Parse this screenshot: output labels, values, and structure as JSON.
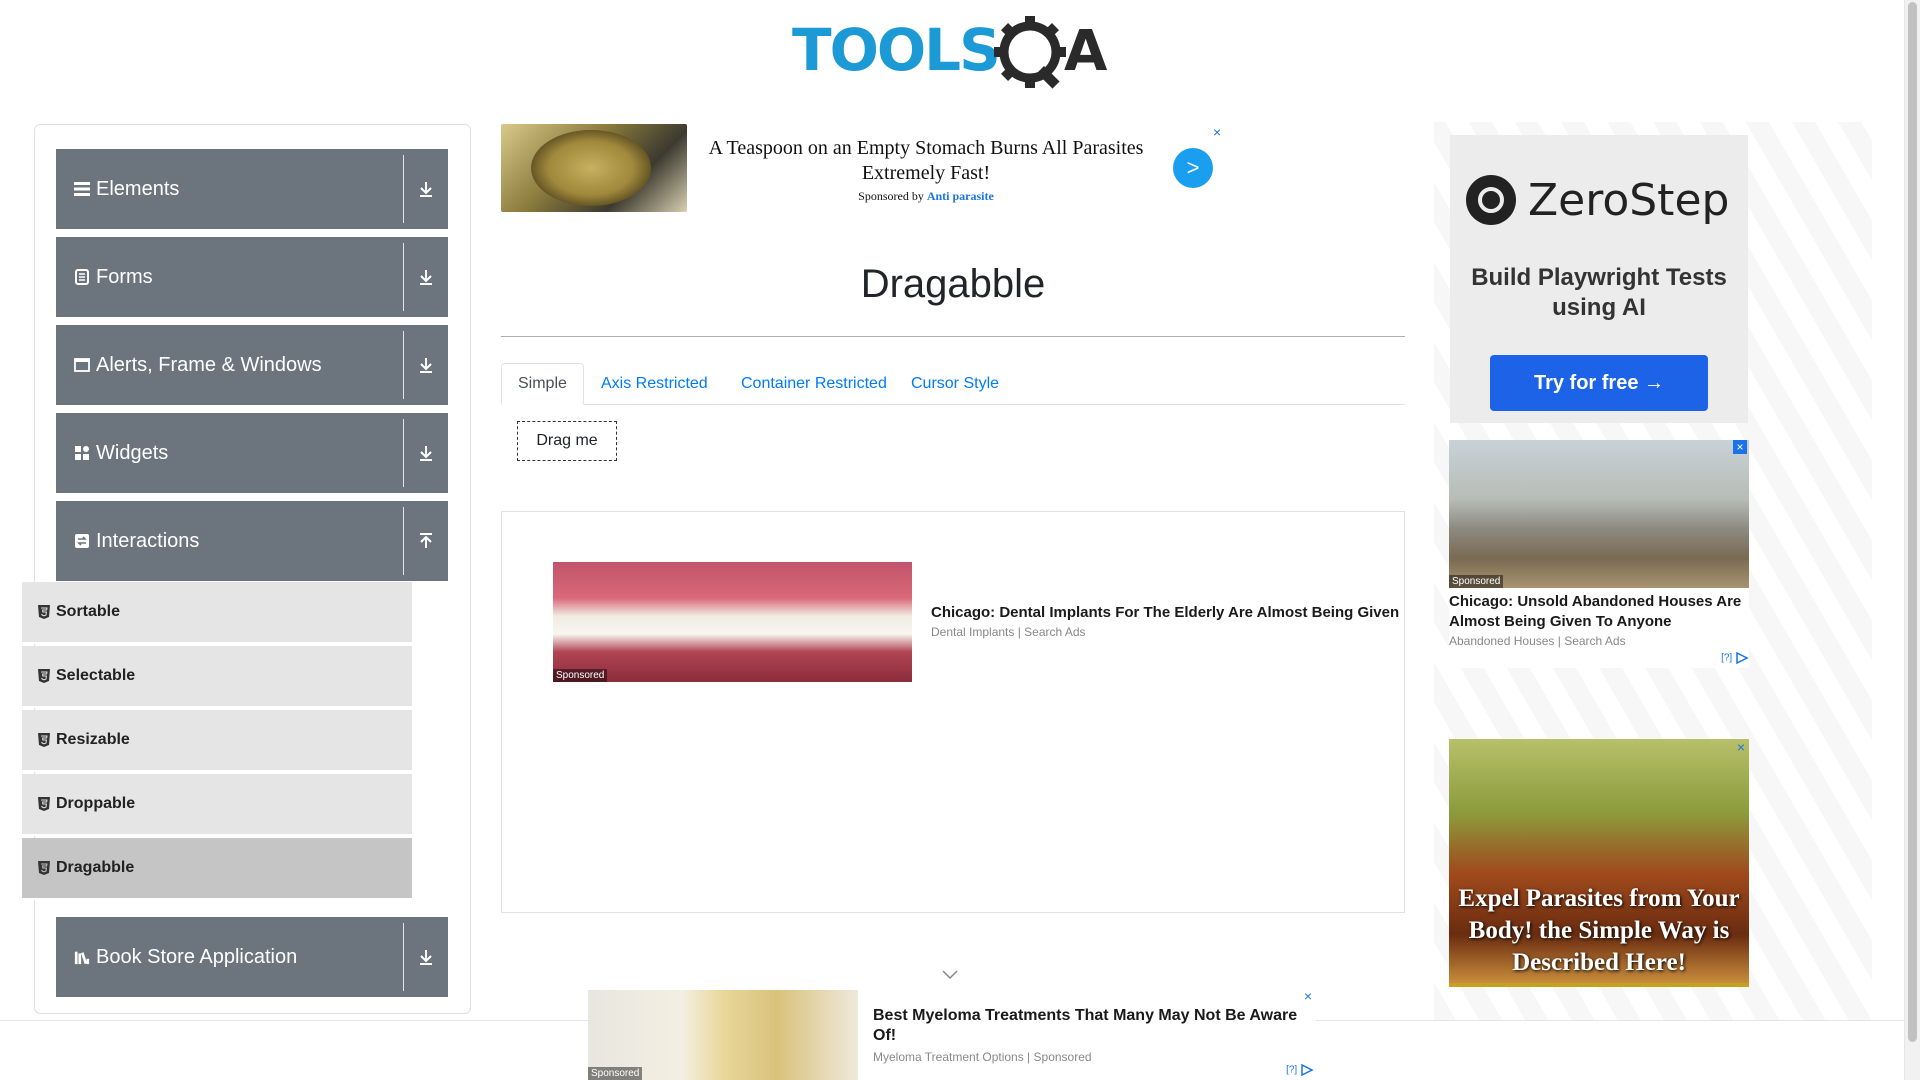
{
  "logo": {
    "text": "TOOLSQA"
  },
  "sidebar": {
    "groups": [
      {
        "label": "Elements",
        "icon": "list-icon",
        "arrow": "download-arrow-icon"
      },
      {
        "label": "Forms",
        "icon": "document-icon",
        "arrow": "download-arrow-icon"
      },
      {
        "label": "Alerts, Frame & Windows",
        "icon": "window-icon",
        "arrow": "download-arrow-icon"
      },
      {
        "label": "Widgets",
        "icon": "widgets-icon",
        "arrow": "download-arrow-icon"
      },
      {
        "label": "Interactions",
        "icon": "interactions-icon",
        "arrow": "upload-arrow-icon"
      },
      {
        "label": "Book Store Application",
        "icon": "books-icon",
        "arrow": "download-arrow-icon"
      }
    ],
    "interaction_items": [
      {
        "label": "Sortable"
      },
      {
        "label": "Selectable"
      },
      {
        "label": "Resizable"
      },
      {
        "label": "Droppable"
      },
      {
        "label": "Dragabble",
        "active": true
      }
    ]
  },
  "top_ad": {
    "title": "A Teaspoon on an Empty Stomach Burns All Parasites Extremely Fast!",
    "sponsored_prefix": "Sponsored by",
    "sponsor": "Anti parasite",
    "go": ">",
    "close": "×"
  },
  "main": {
    "title": "Dragabble",
    "tabs": [
      {
        "label": "Simple",
        "active": true
      },
      {
        "label": "Axis Restricted"
      },
      {
        "label": "Container Restricted"
      },
      {
        "label": "Cursor Style"
      }
    ],
    "drag_label": "Drag me"
  },
  "mid_ad": {
    "tag": "Sponsored",
    "title": "Chicago: Dental Implants For The Elderly Are Almost Being Given",
    "source": "Dental Implants | Search Ads"
  },
  "right_ads": {
    "zerostep": {
      "brand": "ZeroStep",
      "subtitle": "Build Playwright Tests using AI",
      "button": "Try for free →"
    },
    "house": {
      "tag": "Sponsored",
      "title": "Chicago: Unsold Abandoned Houses Are Almost Being Given To Anyone",
      "source": "Abandoned Houses | Search Ads",
      "adchoices": "[?]",
      "close": "×"
    },
    "parasite": {
      "text": "Expel Parasites from Your Body! the Simple Way is Described Here!",
      "close": "×"
    }
  },
  "bottom_ad": {
    "tag": "Sponsored",
    "title": "Best Myeloma Treatments That Many May Not Be Aware Of!",
    "source": "Myeloma Treatment Options | Sponsored",
    "adchoices": "[?]",
    "close": "×"
  },
  "colors": {
    "sidebar_group": "#6c757d",
    "sub_item": "#e5e5e5",
    "sub_item_active": "#c5c5c5",
    "link": "#007bff",
    "logo_blue": "#1c9ad6"
  }
}
